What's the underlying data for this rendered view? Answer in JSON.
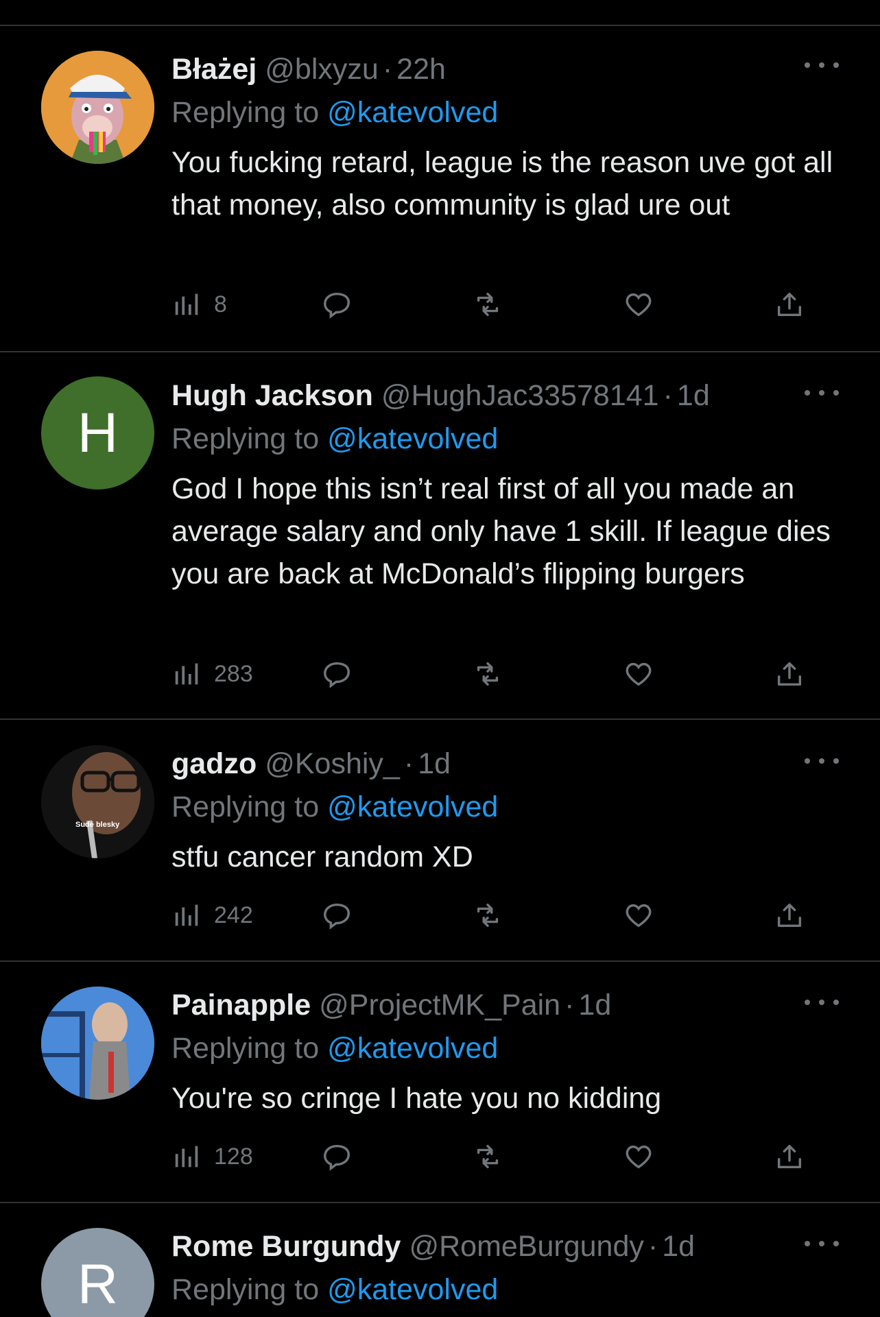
{
  "colors": {
    "background": "#000000",
    "text": "#e7e9ea",
    "muted": "#71767b",
    "link": "#1d9bf0",
    "divider": "#2f3336"
  },
  "replying_prefix": "Replying to",
  "tweets": [
    {
      "name": "Błażej",
      "handle": "@blxyzu",
      "time": "22h",
      "mention": "@katevolved",
      "text": "You fucking retard, league is the reason uve got all that money, also community is glad ure out",
      "views": "8",
      "avatar": {
        "type": "image",
        "icon": "ape-avatar-icon",
        "bg": "#e69a3c"
      }
    },
    {
      "name": "Hugh Jackson",
      "handle": "@HughJac33578141",
      "time": "1d",
      "mention": "@katevolved",
      "text": "God I hope this isn’t real first of all you made an average salary and only have 1 skill. If league dies you are back at McDonald’s flipping burgers",
      "views": "283",
      "avatar": {
        "type": "initial",
        "letter": "H",
        "bg": "#3f6f2a"
      }
    },
    {
      "name": "gadzo",
      "handle": "@Koshiy_",
      "time": "1d",
      "mention": "@katevolved",
      "text": "stfu cancer random XD",
      "views": "242",
      "avatar": {
        "type": "image",
        "icon": "photo-avatar-icon",
        "caption": "Sudé blesky",
        "bg": "#1a1a1a"
      }
    },
    {
      "name": "Painapple",
      "handle": "@ProjectMK_Pain",
      "time": "1d",
      "mention": "@katevolved",
      "text": "You're so cringe I hate you no kidding",
      "views": "128",
      "avatar": {
        "type": "image",
        "icon": "cartoon-avatar-icon",
        "bg": "#3f7fcc"
      }
    },
    {
      "name": "Rome Burgundy",
      "handle": "@RomeBurgundy",
      "time": "1d",
      "mention": "@katevolved",
      "text": "",
      "views": "",
      "avatar": {
        "type": "initial",
        "letter": "R",
        "bg": "#8b9aa6"
      }
    }
  ]
}
